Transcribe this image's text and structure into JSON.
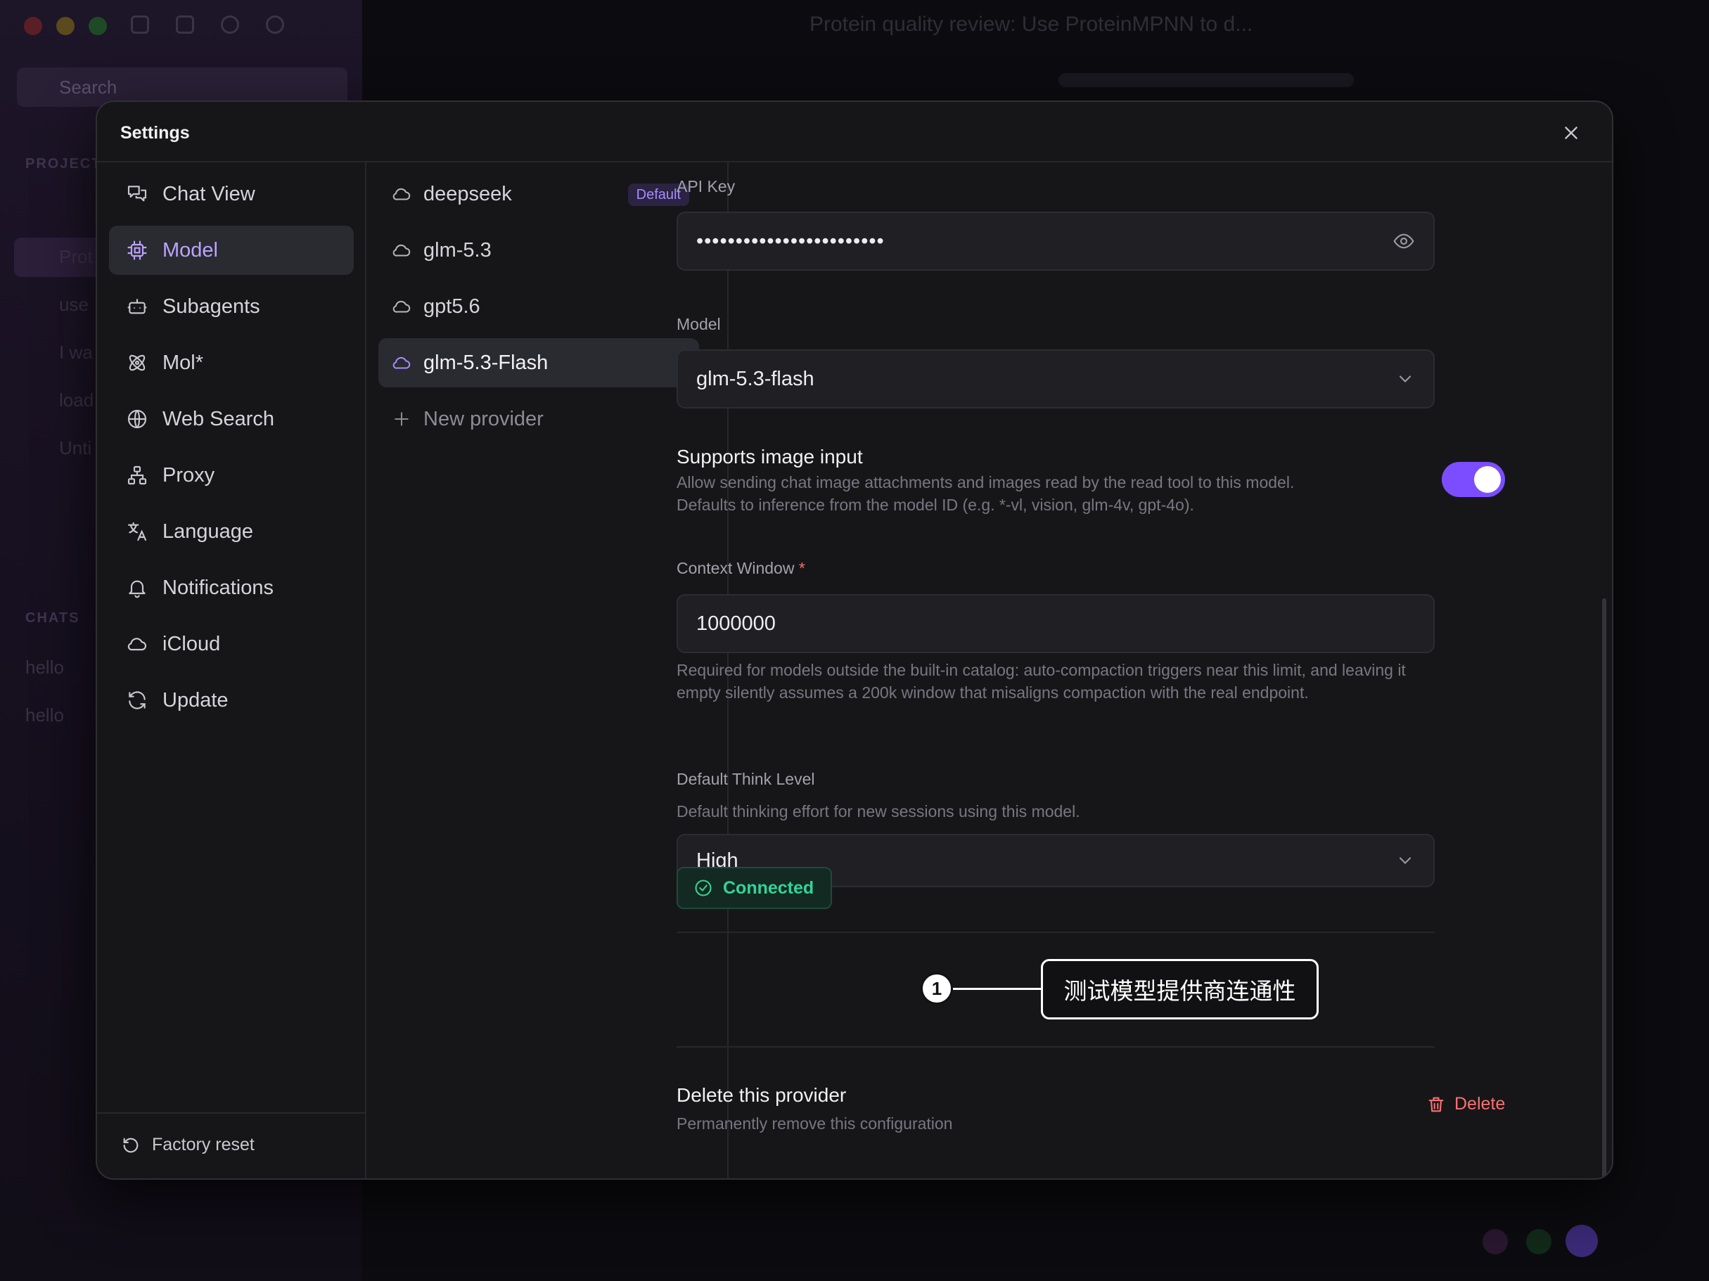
{
  "background_app": {
    "title": "Protein quality review: Use ProteinMPNN to d...",
    "search_placeholder": "Search",
    "sections": [
      "PROJECTS",
      "CHATS"
    ],
    "items": [
      "Prot",
      "use",
      "I wa",
      "load",
      "Unti",
      "hello",
      "hello"
    ]
  },
  "dialog": {
    "title": "Settings",
    "close_icon": "close-icon"
  },
  "nav": {
    "items": [
      {
        "label": "Chat View",
        "icon": "chat-bubbles-icon",
        "active": false
      },
      {
        "label": "Model",
        "icon": "chip-icon",
        "active": true
      },
      {
        "label": "Subagents",
        "icon": "robot-icon",
        "active": false
      },
      {
        "label": "Mol*",
        "icon": "atom-icon",
        "active": false
      },
      {
        "label": "Web Search",
        "icon": "globe-icon",
        "active": false
      },
      {
        "label": "Proxy",
        "icon": "network-icon",
        "active": false
      },
      {
        "label": "Language",
        "icon": "translate-icon",
        "active": false
      },
      {
        "label": "Notifications",
        "icon": "bell-icon",
        "active": false
      },
      {
        "label": "iCloud",
        "icon": "cloud-icon",
        "active": false
      },
      {
        "label": "Update",
        "icon": "refresh-icon",
        "active": false
      }
    ],
    "footer": {
      "label": "Factory reset",
      "icon": "reset-icon"
    }
  },
  "providers": {
    "items": [
      {
        "label": "deepseek",
        "badge": "Default",
        "active": false
      },
      {
        "label": "glm-5.3",
        "badge": "",
        "active": false
      },
      {
        "label": "gpt5.6",
        "badge": "",
        "active": false
      },
      {
        "label": "glm-5.3-Flash",
        "badge": "",
        "active": true
      }
    ],
    "add_label": "New provider"
  },
  "form": {
    "api_key": {
      "label": "API Key",
      "value": "••••••••••••••••••••••••"
    },
    "model": {
      "label": "Model",
      "value": "glm-5.3-flash"
    },
    "image_input": {
      "title": "Supports image input",
      "description": "Allow sending chat image attachments and images read by the read tool to this model. Defaults to inference from the model ID (e.g. *-vl, vision, glm-4v, gpt-4o).",
      "enabled": true
    },
    "context_window": {
      "label": "Context Window",
      "required_mark": "*",
      "value": "1000000",
      "help": "Required for models outside the built-in catalog: auto-compaction triggers near this limit, and leaving it empty silently assumes a 200k window that misaligns compaction with the real endpoint."
    },
    "think_level": {
      "label": "Default Think Level",
      "help": "Default thinking effort for new sessions using this model.",
      "value": "High"
    },
    "status": {
      "label": "Connected"
    },
    "delete_section": {
      "title": "Delete this provider",
      "description": "Permanently remove this configuration",
      "button": "Delete"
    }
  },
  "annotation": {
    "number": "1",
    "text": "测试模型提供商连通性"
  },
  "colors": {
    "accent": "#7c4dff",
    "accent_text": "#bba3ff",
    "success": "#34d399",
    "danger": "#f87171"
  }
}
